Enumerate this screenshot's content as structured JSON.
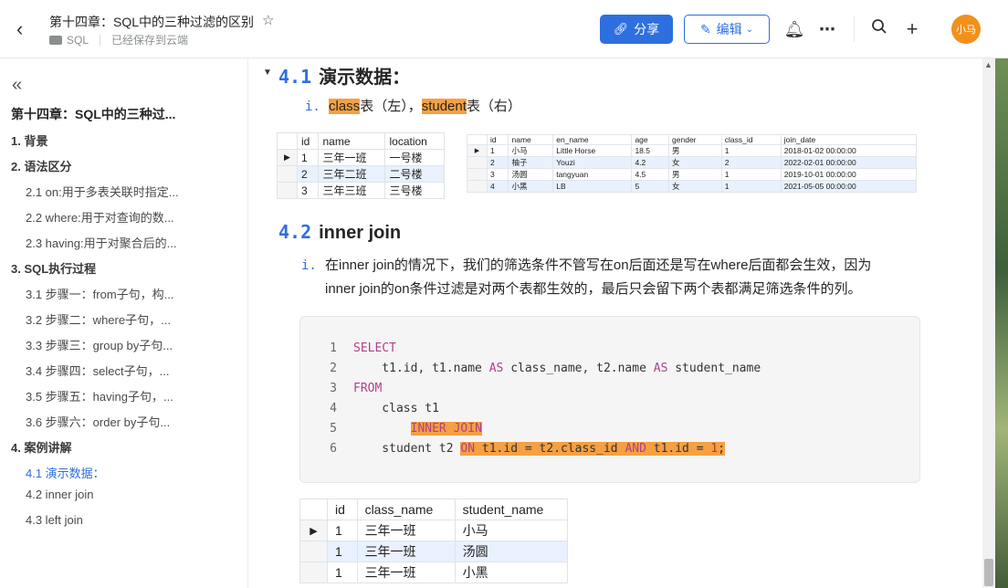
{
  "header": {
    "title": "第十四章：SQL中的三种过滤的区别",
    "folder": "SQL",
    "save_status": "已经保存到云端",
    "share_label": "分享",
    "edit_label": "编辑",
    "avatar_text": "小马"
  },
  "sidebar": {
    "doc_title": "第十四章：SQL中的三种过...",
    "items": [
      {
        "label": "1. 背景"
      },
      {
        "label": "2. 语法区分"
      },
      {
        "label": "2.1 on:用于多表关联时指定..."
      },
      {
        "label": "2.2 where:用于对查询的数..."
      },
      {
        "label": "2.3 having:用于对聚合后的..."
      },
      {
        "label": "3. SQL执行过程"
      },
      {
        "label": "3.1 步骤一：from子句，构..."
      },
      {
        "label": "3.2 步骤二：where子句，..."
      },
      {
        "label": "3.3 步骤三：group by子句..."
      },
      {
        "label": "3.4 步骤四：select子句，..."
      },
      {
        "label": "3.5 步骤五：having子句，..."
      },
      {
        "label": "3.6 步骤六：order by子句..."
      },
      {
        "label": "4. 案例讲解"
      },
      {
        "label": "4.1 演示数据："
      },
      {
        "label": "4.2 inner join"
      },
      {
        "label": "4.3 left join"
      }
    ]
  },
  "content": {
    "sec41": {
      "num": "4.1",
      "title": "演示数据："
    },
    "sec41_item": {
      "mark": "i.",
      "a": "class",
      "b": "表（左），",
      "c": "student",
      "d": "表（右）"
    },
    "class_table": {
      "columns": [
        "id",
        "name",
        "location"
      ],
      "rows": [
        [
          "1",
          "三年一班",
          "一号楼"
        ],
        [
          "2",
          "三年二班",
          "二号楼"
        ],
        [
          "3",
          "三年三班",
          "三号楼"
        ]
      ]
    },
    "student_table": {
      "columns": [
        "id",
        "name",
        "en_name",
        "age",
        "gender",
        "class_id",
        "join_date"
      ],
      "rows": [
        [
          "1",
          "小马",
          "Little Horse",
          "18.5",
          "男",
          "1",
          "2018-01-02 00:00:00"
        ],
        [
          "2",
          "柚子",
          "Youzi",
          "4.2",
          "女",
          "2",
          "2022-02-01 00:00:00"
        ],
        [
          "3",
          "汤圆",
          "tangyuan",
          "4.5",
          "男",
          "1",
          "2019-10-01 00:00:00"
        ],
        [
          "4",
          "小黑",
          "LB",
          "5",
          "女",
          "1",
          "2021-05-05 00:00:00"
        ]
      ]
    },
    "sec42": {
      "num": "4.2",
      "title": "inner join"
    },
    "sec42_item": {
      "mark": "i.",
      "line1": "在inner join的情况下，我们的筛选条件不管写在on后面还是写在where后面都会生效，因为",
      "line2": "inner join的on条件过滤是对两个表都生效的，最后只会留下两个表都满足筛选条件的列。"
    },
    "code": {
      "ln": [
        "1",
        "2",
        "3",
        "4",
        "5",
        "6"
      ],
      "l1": "SELECT",
      "l2a": "    t1.id, t1.name ",
      "l2b": "AS",
      "l2c": " class_name, t2.name ",
      "l2d": "AS",
      "l2e": " student_name",
      "l3": "FROM",
      "l4": "    class t1",
      "l5a": "        ",
      "l5b": "INNER JOIN",
      "l6a": "    student t2 ",
      "l6b": "ON",
      "l6c": " t1.id = t2.class_id ",
      "l6d": "AND",
      "l6e": " t1.id = ",
      "l6f": "1",
      "l6g": ";"
    },
    "result_table": {
      "columns": [
        "id",
        "class_name",
        "student_name"
      ],
      "rows": [
        [
          "1",
          "三年一班",
          "小马"
        ],
        [
          "1",
          "三年一班",
          "汤圆"
        ],
        [
          "1",
          "三年一班",
          "小黑"
        ]
      ]
    }
  }
}
